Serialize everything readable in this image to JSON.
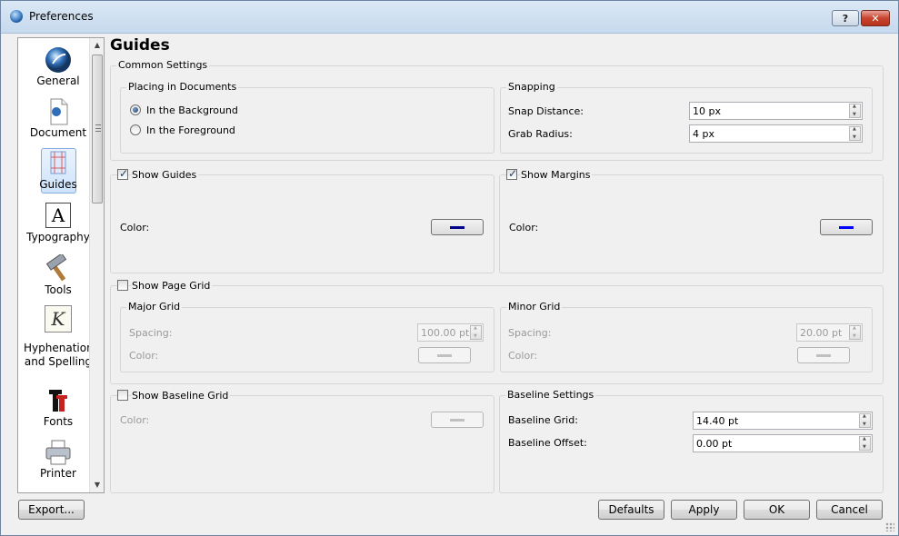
{
  "window": {
    "title": "Preferences",
    "help_label": "?",
    "close_label": "✕"
  },
  "sidebar": {
    "items": [
      {
        "label": "General",
        "icon": "globe-icon"
      },
      {
        "label": "Document",
        "icon": "document-icon"
      },
      {
        "label": "Guides",
        "icon": "guides-icon",
        "selected": true
      },
      {
        "label": "Typography",
        "icon": "typography-icon",
        "glyph": "A"
      },
      {
        "label": "Tools",
        "icon": "hammer-icon"
      },
      {
        "label": "Hyphenation",
        "label2": "and Spelling",
        "icon": "hyphenation-icon",
        "glyph": "K"
      },
      {
        "label": "Fonts",
        "icon": "fonts-icon"
      },
      {
        "label": "Printer",
        "icon": "printer-icon"
      }
    ],
    "scroll_up": "▲",
    "scroll_down": "▼"
  },
  "page": {
    "title": "Guides",
    "common": {
      "title": "Common Settings",
      "placing": {
        "title": "Placing in Documents",
        "background": "In the Background",
        "foreground": "In the Foreground",
        "selected": "background"
      },
      "snapping": {
        "title": "Snapping",
        "snap_distance_label": "Snap Distance:",
        "snap_distance": "10 px",
        "grab_radius_label": "Grab Radius:",
        "grab_radius": "4  px"
      }
    },
    "show_guides": {
      "label": "Show Guides",
      "checked": true,
      "color_label": "Color:",
      "color": "#00008b"
    },
    "show_margins": {
      "label": "Show Margins",
      "checked": true,
      "color_label": "Color:",
      "color": "#0000ff"
    },
    "page_grid": {
      "label": "Show Page Grid",
      "checked": false,
      "major": {
        "title": "Major Grid",
        "spacing_label": "Spacing:",
        "spacing": "100.00 pt",
        "color_label": "Color:"
      },
      "minor": {
        "title": "Minor Grid",
        "spacing_label": "Spacing:",
        "spacing": "20.00 pt",
        "color_label": "Color:"
      }
    },
    "baseline_grid": {
      "label": "Show Baseline Grid",
      "checked": false,
      "color_label": "Color:"
    },
    "baseline_settings": {
      "title": "Baseline Settings",
      "grid_label": "Baseline Grid:",
      "grid": "14.40 pt",
      "offset_label": "Baseline Offset:",
      "offset": "0.00 pt"
    }
  },
  "buttons": {
    "export": "Export...",
    "defaults": "Defaults",
    "apply": "Apply",
    "ok": "OK",
    "cancel": "Cancel"
  }
}
